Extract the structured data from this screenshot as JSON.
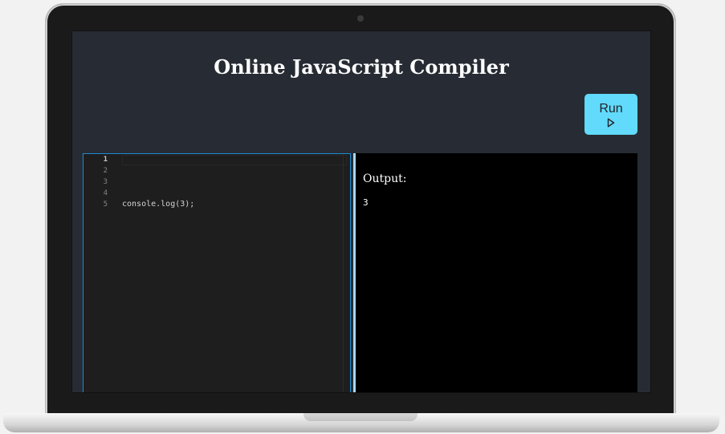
{
  "app": {
    "title": "Online JavaScript Compiler"
  },
  "toolbar": {
    "run_label": "Run",
    "run_icon": "play-icon"
  },
  "editor": {
    "line_numbers": [
      "1",
      "2",
      "3",
      "4",
      "5"
    ],
    "active_line": 1,
    "lines": [
      "",
      "",
      "",
      "",
      "console.log(3);"
    ]
  },
  "output": {
    "label": "Output:",
    "text": "3"
  },
  "colors": {
    "accent": "#61dafb",
    "background": "#272c34",
    "editor_bg": "#1e1e1e",
    "output_bg": "#000000"
  }
}
